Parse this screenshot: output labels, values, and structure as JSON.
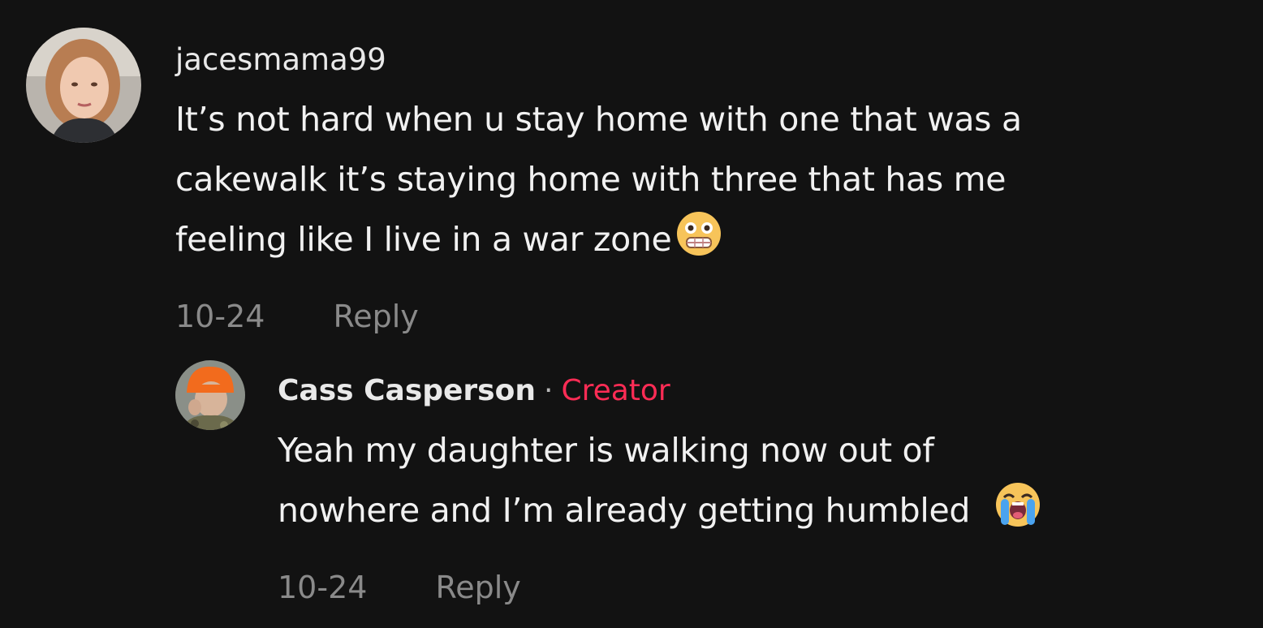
{
  "comments": [
    {
      "username": "jacesmama99",
      "text_line1": "It’s not hard when u stay home with one that was a",
      "text_line2": "cakewalk it’s staying home with three that has me",
      "text_line3": "feeling like I live in a war zone",
      "emoji": "grimacing-face-emoji",
      "date": "10-24",
      "reply_label": "Reply"
    },
    {
      "username": "Cass Casperson",
      "separator": "·",
      "badge": "Creator",
      "text_line1": "Yeah my daughter is walking now out of",
      "text_line2": "nowhere and I’m already getting humbled",
      "emoji": "loudly-crying-face-emoji",
      "date": "10-24",
      "reply_label": "Reply"
    }
  ],
  "colors": {
    "background": "#121212",
    "creator_badge": "#fe2c55",
    "meta_text": "#8a8a8a"
  }
}
